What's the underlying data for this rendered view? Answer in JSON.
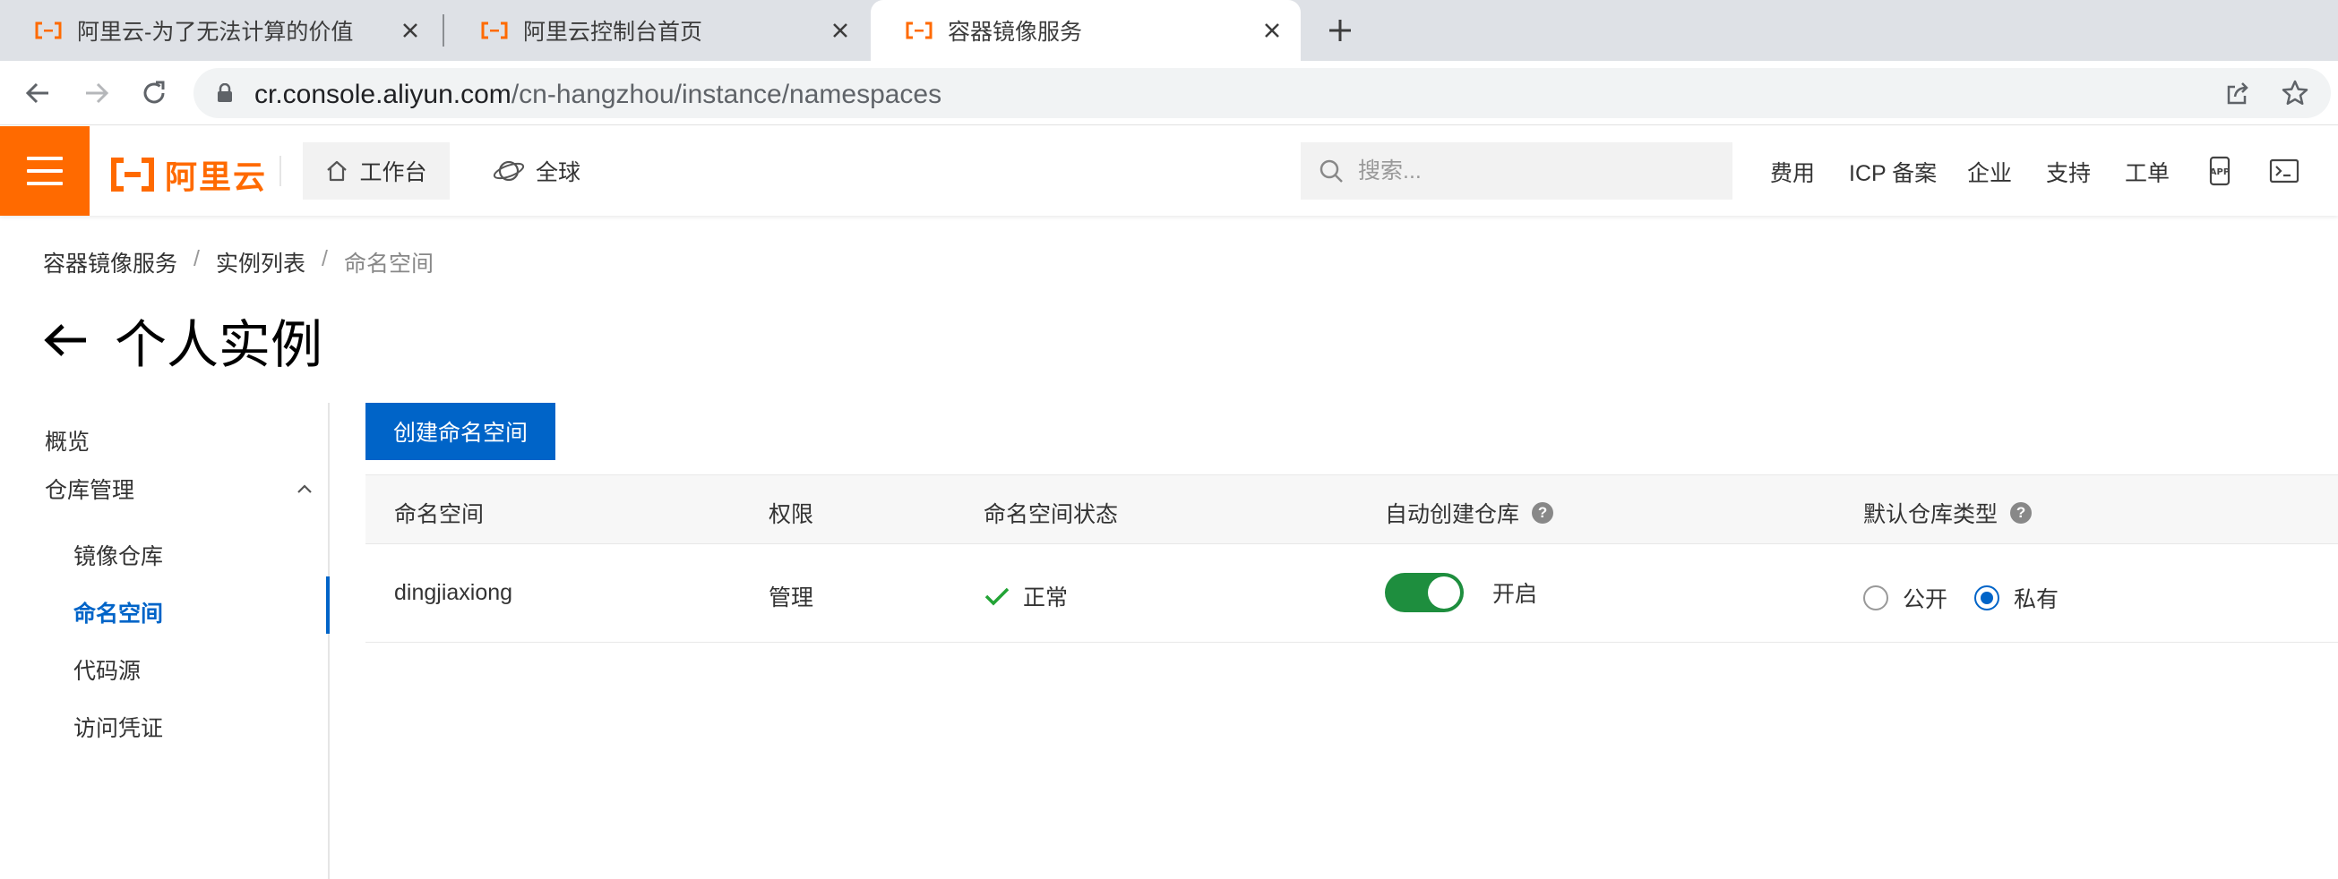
{
  "browser": {
    "tabs": [
      {
        "title": "阿里云-为了无法计算的价值",
        "active": false
      },
      {
        "title": "阿里云控制台首页",
        "active": false
      },
      {
        "title": "容器镜像服务",
        "active": true
      }
    ],
    "url_host": "cr.console.aliyun.com",
    "url_path": "/cn-hangzhou/instance/namespaces"
  },
  "topnav": {
    "brand": "阿里云",
    "workbench": "工作台",
    "region": "全球",
    "search_placeholder": "搜索...",
    "links": [
      "费用",
      "ICP 备案",
      "企业",
      "支持",
      "工单"
    ],
    "icons": [
      "app-icon",
      "terminal-icon"
    ]
  },
  "breadcrumb": {
    "items": [
      "容器镜像服务",
      "实例列表",
      "命名空间"
    ],
    "separator": "/"
  },
  "page": {
    "title": "个人实例"
  },
  "sidebar": {
    "overview": "概览",
    "group": "仓库管理",
    "items": [
      "镜像仓库",
      "命名空间",
      "代码源",
      "访问凭证"
    ],
    "active": "命名空间"
  },
  "main": {
    "create_button": "创建命名空间",
    "columns": [
      "命名空间",
      "权限",
      "命名空间状态",
      "自动创建仓库",
      "默认仓库类型"
    ],
    "help_glyph": "?",
    "rows": [
      {
        "namespace": "dingjiaxiong",
        "permission": "管理",
        "status": "正常",
        "auto_create": "开启",
        "auto_create_on": true,
        "repo_type_options": [
          "公开",
          "私有"
        ],
        "repo_type_selected": "私有"
      }
    ]
  },
  "colors": {
    "brand_orange": "#ff6a00",
    "primary_blue": "#0064c8",
    "status_green": "#1e8e3e",
    "check_green": "#23a436"
  }
}
